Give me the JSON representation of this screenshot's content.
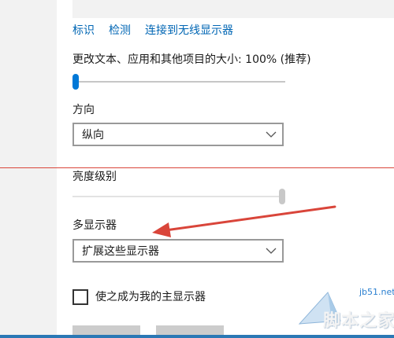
{
  "links": {
    "identify": "标识",
    "detect": "检测",
    "connect_wireless": "连接到无线显示器"
  },
  "scale": {
    "label": "更改文本、应用和其他项目的大小: 100% (推荐)",
    "slider_level": 0.0
  },
  "orientation": {
    "label": "方向",
    "selected": "纵向"
  },
  "brightness": {
    "label": "亮度级别",
    "slider_level": 1.0
  },
  "multiple_displays": {
    "label": "多显示器",
    "selected": "扩展这些显示器"
  },
  "main_display": {
    "label": "使之成为我的主显示器",
    "checked": false
  },
  "watermark": {
    "url": "jb51.net",
    "name": "脚本之家"
  },
  "colors": {
    "link": "#0066b4",
    "accent": "#0078d7",
    "annotation": "#d9453a"
  },
  "icons": {
    "dropdown": "chevron-down-icon",
    "annotation": "red-arrow-icon"
  }
}
